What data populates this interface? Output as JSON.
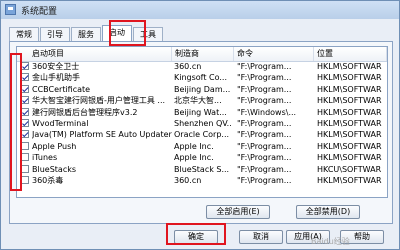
{
  "window": {
    "title": "系统配置"
  },
  "tabs": [
    {
      "label": "常规"
    },
    {
      "label": "引导"
    },
    {
      "label": "服务"
    },
    {
      "label": "启动"
    },
    {
      "label": "工具"
    }
  ],
  "list": {
    "headers": {
      "item": "启动项目",
      "maker": "制造商",
      "command": "命令",
      "location": "位置"
    },
    "rows": [
      {
        "checked": true,
        "item": "360安全卫士",
        "maker": "360.cn",
        "command": "\"F:\\Program...",
        "location": "HKLM\\SOFTWAR"
      },
      {
        "checked": true,
        "item": "金山手机助手",
        "maker": "Kingsoft Co...",
        "command": "\"F:\\Program...",
        "location": "HKLM\\SOFTWAR"
      },
      {
        "checked": true,
        "item": "CCBCertificate",
        "maker": "Beijing Dam...",
        "command": "\"F:\\Program...",
        "location": "HKLM\\SOFTWAR"
      },
      {
        "checked": true,
        "item": "华大智宝建行网银盾-用户管理工具 ...",
        "maker": "北京华大智...",
        "command": "\"F:\\Program...",
        "location": "HKLM\\SOFTWAR"
      },
      {
        "checked": true,
        "item": "建行网银盾后台管理程序v3.2",
        "maker": "Beijing Wat...",
        "command": "\"F:\\Windows\\...",
        "location": "HKLM\\SOFTWAR"
      },
      {
        "checked": true,
        "item": "WvodTerminal",
        "maker": "Shenzhen QV...",
        "command": "\"F:\\Program...",
        "location": "HKLM\\SOFTWAR"
      },
      {
        "checked": true,
        "item": "Java(TM) Platform SE Auto Updater",
        "maker": "Oracle Corp...",
        "command": "\"F:\\Program...",
        "location": "HKLM\\SOFTWAR"
      },
      {
        "checked": false,
        "item": "Apple Push",
        "maker": "Apple Inc.",
        "command": "\"F:\\Program...",
        "location": "HKLM\\SOFTWAR"
      },
      {
        "checked": false,
        "item": "iTunes",
        "maker": "Apple Inc.",
        "command": "\"F:\\Program...",
        "location": "HKLM\\SOFTWAR"
      },
      {
        "checked": false,
        "item": "BlueStacks",
        "maker": "BlueStack S...",
        "command": "\"F:\\Program...",
        "location": "HKCU\\SOFTWAR"
      },
      {
        "checked": false,
        "item": "360杀毒",
        "maker": "360.cn",
        "command": "\"F:\\Program...",
        "location": "HKLM\\SOFTWAR"
      }
    ]
  },
  "buttons": {
    "enable_all": "全部启用(E)",
    "disable_all": "全部禁用(D)",
    "ok": "确定",
    "cancel": "取消",
    "apply": "应用(A)",
    "help": "帮助"
  },
  "watermark": "Baidu经验",
  "colors": {
    "highlight": "#e0151f",
    "accent": "#8ba3c4"
  }
}
